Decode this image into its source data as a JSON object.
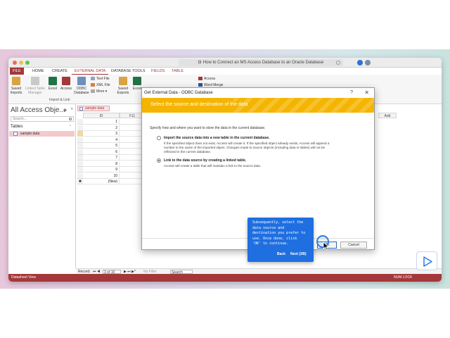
{
  "browser": {
    "title": "How to Connect an MS Access Database to an Oracle Database"
  },
  "ribbon": {
    "tabs": [
      "FILE",
      "HOME",
      "CREATE",
      "EXTERNAL DATA",
      "DATABASE TOOLS",
      "FIELDS",
      "TABLE"
    ],
    "active_tab": "EXTERNAL DATA",
    "buttons": {
      "saved_imports": "Saved Imports",
      "linked_table_manager": "Linked Table Manager",
      "excel": "Excel",
      "access": "Access",
      "odbc_database": "ODBC Database",
      "text_file": "Text File",
      "xml_file": "XML File",
      "more": "More",
      "saved_exports": "Saved Exports",
      "excel_export": "Excel",
      "access_export": "Access",
      "word_merge": "Word Merge"
    },
    "group_label": "Import & Link"
  },
  "nav": {
    "title": "All Access Obje...",
    "search_placeholder": "Search...",
    "section": "Tables",
    "items": [
      "sample data"
    ]
  },
  "sheet": {
    "tab_label": "sample data",
    "columns": [
      "ID",
      "F11",
      "Add"
    ],
    "rows": [
      "1",
      "2",
      "3",
      "4",
      "5",
      "6",
      "7",
      "8",
      "9",
      "10",
      "(New)"
    ]
  },
  "record_bar": {
    "record_label": "Record:",
    "position": "3 of 10",
    "filter": "No Filter",
    "search": "Search"
  },
  "status": {
    "left": "Datasheet View",
    "right": "NUM LOCK"
  },
  "dialog": {
    "title": "Get External Data - ODBC Database",
    "help": "?",
    "close": "✕",
    "heading": "Select the source and destination of the data",
    "intro": "Specify how and where you want to store the data in the current database.",
    "option1_title": "Import the source data into a new table in the current database.",
    "option1_desc_1": "If the specified object does not exist, Access will create it. If the specified object already exists, Access will append a",
    "option1_desc_2": "number to the name of the imported object. Changes made to source objects (including data in tables) will not be",
    "option1_desc_3": "reflected in the current database.",
    "option2_title": "Link to the data source by creating a linked table.",
    "option2_desc": "Access will create a table that will maintain a link to the source data.",
    "selected_option": 2,
    "ok_label": "OK",
    "cancel_label": "Cancel"
  },
  "tooltip": {
    "line1": "Subsequently, select the",
    "line2": "data source and",
    "line3": "destination you prefer to",
    "line4": "use. Once done, click",
    "line5": "'OK' to continue.",
    "back_label": "Back",
    "next_label": "Next (3/8)"
  },
  "colors": {
    "access_red": "#a4373a",
    "banner_yellow": "#f4b400",
    "tooltip_blue": "#1f6fe0"
  }
}
